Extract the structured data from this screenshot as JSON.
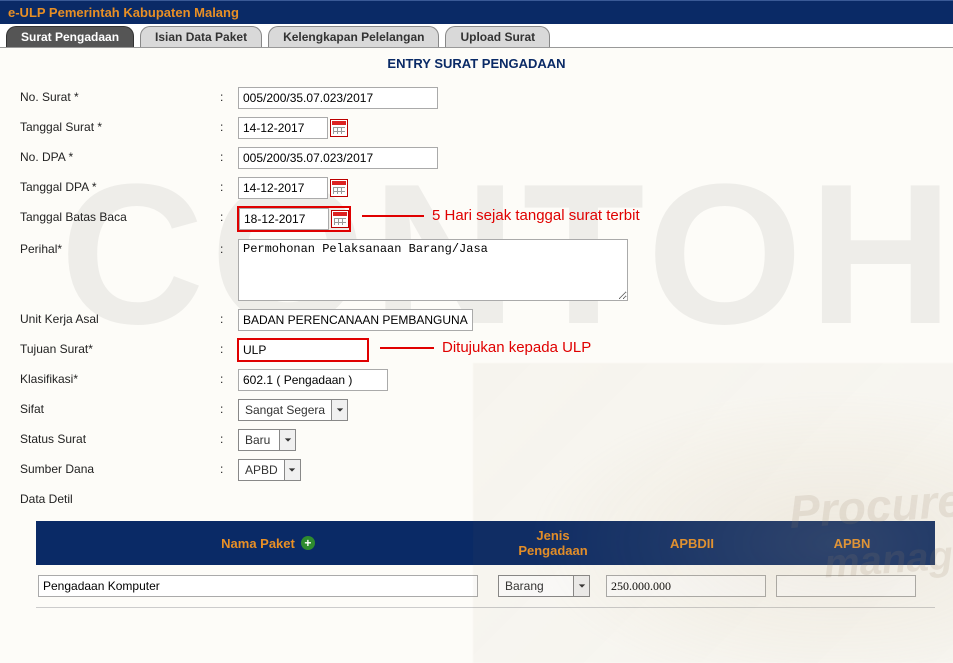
{
  "app_title": "e-ULP Pemerintah Kabupaten Malang",
  "watermark": "CONTOH",
  "tabs": {
    "surat_pengadaan": "Surat Pengadaan",
    "isian_data_paket": "Isian Data Paket",
    "kelengkapan_pelelangan": "Kelengkapan Pelelangan",
    "upload_surat": "Upload Surat"
  },
  "subtitle": "ENTRY SURAT PENGADAAN",
  "labels": {
    "no_surat": "No. Surat *",
    "tgl_surat": "Tanggal Surat *",
    "no_dpa": "No. DPA *",
    "tgl_dpa": "Tanggal DPA *",
    "tgl_batas_baca": "Tanggal Batas Baca",
    "perihal": "Perihal*",
    "unit_kerja": "Unit Kerja Asal",
    "tujuan": "Tujuan Surat*",
    "klasifikasi": "Klasifikasi*",
    "sifat": "Sifat",
    "status": "Status Surat",
    "sumber_dana": "Sumber Dana",
    "data_detil": "Data Detil"
  },
  "values": {
    "no_surat": "005/200/35.07.023/2017",
    "tgl_surat": "14-12-2017",
    "no_dpa": "005/200/35.07.023/2017",
    "tgl_dpa": "14-12-2017",
    "tgl_batas_baca": "18-12-2017",
    "perihal": "Permohonan Pelaksanaan Barang/Jasa",
    "unit_kerja": "BADAN PERENCANAAN PEMBANGUNAN DAERAH",
    "tujuan": "ULP",
    "klasifikasi": "602.1 ( Pengadaan )",
    "sifat": "Sangat Segera",
    "status": "Baru",
    "sumber_dana": "APBD"
  },
  "annotations": {
    "batas_baca": "5 Hari sejak tanggal surat terbit",
    "tujuan": "Ditujukan kepada ULP"
  },
  "detail": {
    "headers": {
      "nama_paket": "Nama Paket",
      "jenis_pengadaan": "Jenis Pengadaan",
      "apbdii": "APBDII",
      "apbn": "APBN"
    },
    "row": {
      "nama_paket": "Pengadaan Komputer",
      "jenis_selected": "Barang",
      "apbdii": "250.000.000",
      "apbn": ""
    }
  },
  "bg": {
    "t1": "Procure",
    "t2": "manag"
  }
}
